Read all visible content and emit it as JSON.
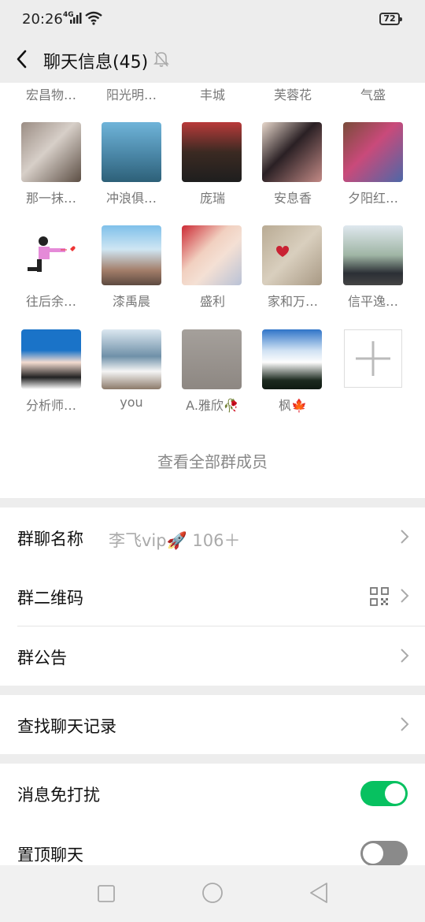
{
  "status": {
    "time": "20:26",
    "network": "4G",
    "battery": "72"
  },
  "nav": {
    "title": "聊天信息(45)"
  },
  "members": {
    "partial_row": [
      "宏昌物…",
      "阳光明…",
      "丰城",
      "芙蓉花",
      "气盛"
    ],
    "rows": [
      [
        "那一抹…",
        "冲浪俱…",
        "庞瑞",
        "安息香",
        "夕阳红…"
      ],
      [
        "往后余…",
        "漆禹晨",
        "盛利",
        "家和万…",
        "信平逸…"
      ],
      [
        "分析师…",
        "you",
        "A.雅欣🥀",
        "枫🍁"
      ]
    ],
    "view_all": "查看全部群成员"
  },
  "settings": {
    "group_name_label": "群聊名称",
    "group_name_value": "李飞vip🚀 106＋",
    "qr_label": "群二维码",
    "notice_label": "群公告",
    "search_label": "查找聊天记录",
    "mute_label": "消息免打扰",
    "pin_label": "置顶聊天",
    "mute_on": true,
    "pin_on": false
  },
  "colors": {
    "toggle_on": "#07c160",
    "toggle_off": "#8a8a8a",
    "background": "#ededed"
  }
}
